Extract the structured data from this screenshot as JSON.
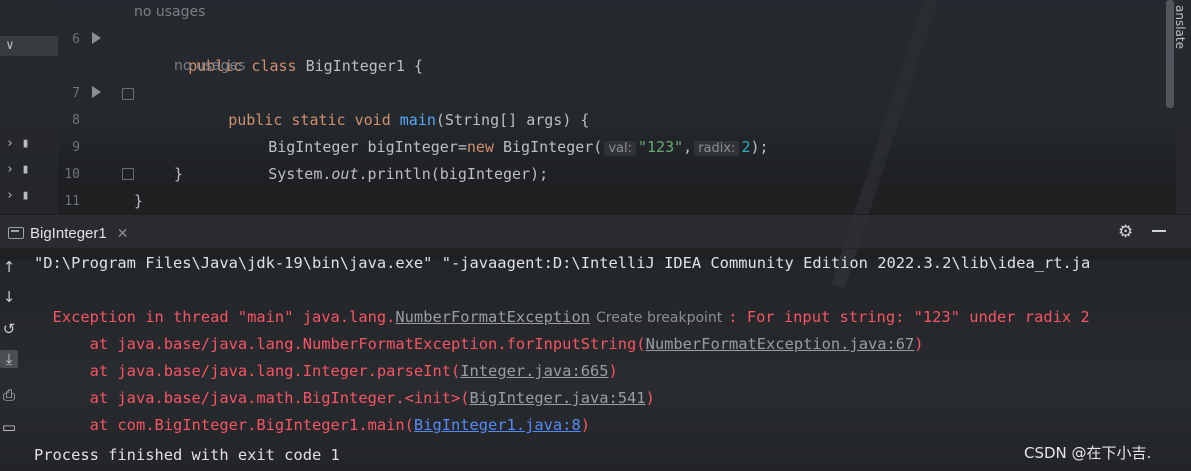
{
  "editor": {
    "lines": [
      {
        "number": "6",
        "hint_above": "no usages",
        "code": {
          "kw": "public class ",
          "name": "BigInteger1",
          "rest": " {"
        }
      },
      {
        "number": "7",
        "hint_above": "no usages",
        "code": {
          "kw": "public static void ",
          "fn": "main",
          "rest": "(String[] args) {"
        }
      },
      {
        "number": "8",
        "code": {
          "pre": "BigInteger bigInteger=",
          "kw": "new",
          "mid": " BigInteger(",
          "p1_label": "val:",
          "p1_value": "\"123\"",
          "sep": ",",
          "p2_label": "radix:",
          "p2_value": "2",
          "end": ");"
        }
      },
      {
        "number": "9",
        "code": {
          "pre": "System.",
          "static": "out",
          "rest": ".println(bigInteger);"
        }
      },
      {
        "number": "10",
        "code": {
          "rest": "}"
        }
      },
      {
        "number": "11",
        "code": {
          "rest": "}"
        }
      }
    ],
    "right_tab": "anslate"
  },
  "run": {
    "tab_label": "BigInteger1",
    "output": {
      "command": "\"D:\\Program Files\\Java\\jdk-19\\bin\\java.exe\" \"-javaagent:D:\\IntelliJ IDEA Community Edition 2022.3.2\\lib\\idea_rt.ja",
      "exception_prefix": "Exception in thread \"main\" java.lang.",
      "exception_class": "NumberFormatException",
      "create_breakpoint": "Create breakpoint",
      "exception_message": ": For input string: \"123\" under radix 2",
      "stack": [
        {
          "at": "    at java.base/java.lang.NumberFormatException.forInputString(",
          "link": "NumberFormatException.java:67",
          "end": ")",
          "style": "gray"
        },
        {
          "at": "    at java.base/java.lang.Integer.parseInt(",
          "link": "Integer.java:665",
          "end": ")",
          "style": "gray"
        },
        {
          "at": "    at java.base/java.math.BigInteger.<init>(",
          "link": "BigInteger.java:541",
          "end": ")",
          "style": "gray"
        },
        {
          "at": "    at com.BigInteger.BigInteger1.main(",
          "link": "BigInteger1.java:8",
          "end": ")",
          "style": "blue"
        }
      ],
      "exit": "Process finished with exit code 1"
    }
  },
  "watermark": "CSDN @在下小吉."
}
